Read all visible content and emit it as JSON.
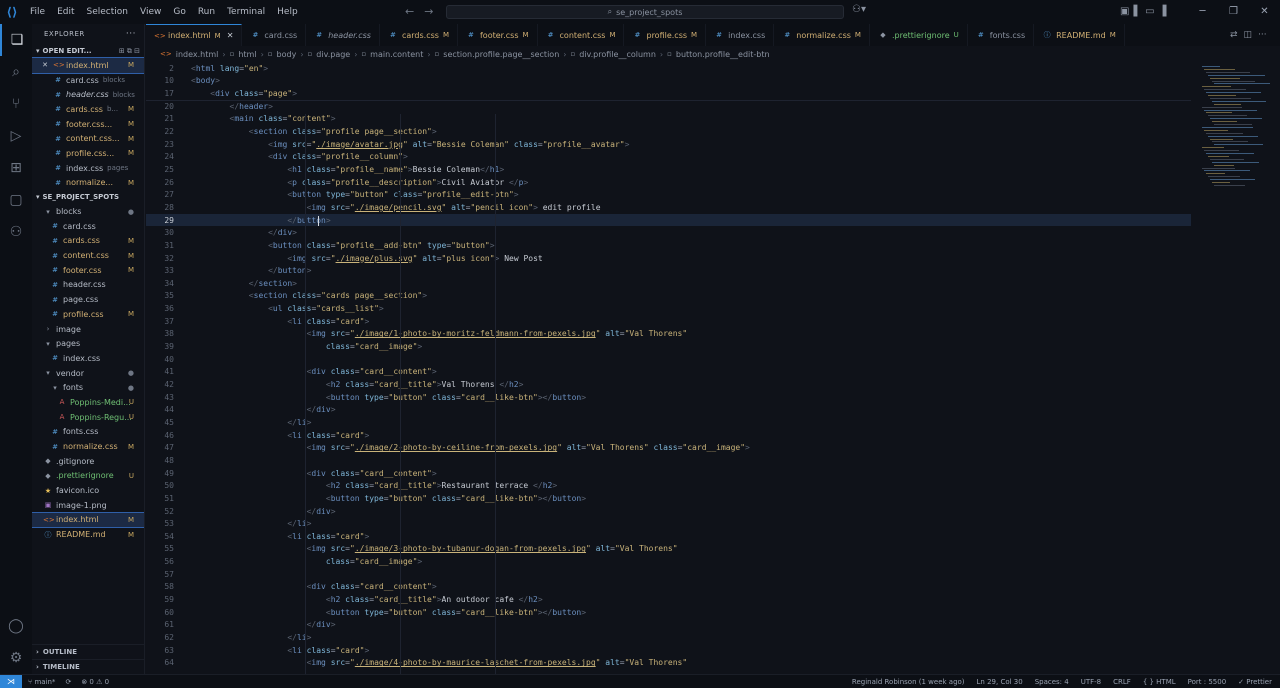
{
  "titlebar": {
    "menu": [
      "File",
      "Edit",
      "Selection",
      "View",
      "Go",
      "Run",
      "Terminal",
      "Help"
    ],
    "search": "se_project_spots"
  },
  "sidebar": {
    "title": "EXPLORER",
    "open_editors_label": "OPEN EDIT...",
    "open_editors": [
      {
        "name": "index.html",
        "desc": "",
        "badge": "M",
        "type": "html",
        "close": true
      },
      {
        "name": "card.css",
        "desc": "blocks",
        "badge": "",
        "type": "css"
      },
      {
        "name": "header.css",
        "desc": "blocks",
        "badge": "",
        "type": "css",
        "italic": true
      },
      {
        "name": "cards.css",
        "desc": "b...",
        "badge": "M",
        "type": "css"
      },
      {
        "name": "footer.css...",
        "desc": "",
        "badge": "M",
        "type": "css"
      },
      {
        "name": "content.css...",
        "desc": "",
        "badge": "M",
        "type": "css"
      },
      {
        "name": "profile.css...",
        "desc": "",
        "badge": "M",
        "type": "css"
      },
      {
        "name": "index.css",
        "desc": "pages",
        "badge": "",
        "type": "css"
      },
      {
        "name": "normalize...",
        "desc": "",
        "badge": "M",
        "type": "css"
      }
    ],
    "project_label": "SE_PROJECT_SPOTS",
    "tree": [
      {
        "name": "blocks",
        "type": "folder",
        "indent": 1,
        "open": true,
        "dot": true
      },
      {
        "name": "card.css",
        "type": "css",
        "indent": 2,
        "badge": ""
      },
      {
        "name": "cards.css",
        "type": "css",
        "indent": 2,
        "badge": "M"
      },
      {
        "name": "content.css",
        "type": "css",
        "indent": 2,
        "badge": "M"
      },
      {
        "name": "footer.css",
        "type": "css",
        "indent": 2,
        "badge": "M"
      },
      {
        "name": "header.css",
        "type": "css",
        "indent": 2,
        "badge": ""
      },
      {
        "name": "page.css",
        "type": "css",
        "indent": 2,
        "badge": ""
      },
      {
        "name": "profile.css",
        "type": "css",
        "indent": 2,
        "badge": "M"
      },
      {
        "name": "image",
        "type": "folder",
        "indent": 1,
        "open": false
      },
      {
        "name": "pages",
        "type": "folder",
        "indent": 1,
        "open": true
      },
      {
        "name": "index.css",
        "type": "css",
        "indent": 2,
        "badge": ""
      },
      {
        "name": "vendor",
        "type": "folder",
        "indent": 1,
        "open": true,
        "dot": true
      },
      {
        "name": "fonts",
        "type": "folder",
        "indent": 2,
        "open": true,
        "dot": true
      },
      {
        "name": "Poppins-Medi...",
        "type": "font",
        "indent": 3,
        "badge": "U"
      },
      {
        "name": "Poppins-Regu...",
        "type": "font",
        "indent": 3,
        "badge": "U"
      },
      {
        "name": "fonts.css",
        "type": "css",
        "indent": 2,
        "badge": ""
      },
      {
        "name": "normalize.css",
        "type": "css",
        "indent": 2,
        "badge": "M"
      },
      {
        "name": ".gitignore",
        "type": "git",
        "indent": 1,
        "badge": ""
      },
      {
        "name": ".prettierignore",
        "type": "git",
        "indent": 1,
        "badge": "U"
      },
      {
        "name": "favicon.ico",
        "type": "star",
        "indent": 1,
        "badge": ""
      },
      {
        "name": "image-1.png",
        "type": "img",
        "indent": 1,
        "badge": ""
      },
      {
        "name": "index.html",
        "type": "html",
        "indent": 1,
        "badge": "M",
        "selected": true
      },
      {
        "name": "README.md",
        "type": "md",
        "indent": 1,
        "badge": "M"
      }
    ],
    "outline_label": "OUTLINE",
    "timeline_label": "TIMELINE"
  },
  "tabs": [
    {
      "name": "index.html",
      "mark": "M",
      "type": "html",
      "active": true,
      "close": true
    },
    {
      "name": "card.css",
      "mark": "",
      "type": "css"
    },
    {
      "name": "header.css",
      "mark": "",
      "type": "css",
      "italic": true
    },
    {
      "name": "cards.css",
      "mark": "M",
      "type": "css"
    },
    {
      "name": "footer.css",
      "mark": "M",
      "type": "css"
    },
    {
      "name": "content.css",
      "mark": "M",
      "type": "css"
    },
    {
      "name": "profile.css",
      "mark": "M",
      "type": "css"
    },
    {
      "name": "index.css",
      "mark": "",
      "type": "css"
    },
    {
      "name": "normalize.css",
      "mark": "M",
      "type": "css"
    },
    {
      "name": ".prettierignore",
      "mark": "U",
      "type": "git"
    },
    {
      "name": "fonts.css",
      "mark": "",
      "type": "css"
    },
    {
      "name": "README.md",
      "mark": "M",
      "type": "md"
    }
  ],
  "breadcrumb": [
    "index.html",
    "html",
    "body",
    "div.page",
    "main.content",
    "section.profile.page__section",
    "div.profile__column",
    "button.profile__edit-btn"
  ],
  "code": [
    {
      "n": "2",
      "html": "<span class='t-dim'>&lt;</span><span class='t-tag'>html</span> <span class='t-attr'>lang</span>=<span class='t-val'>\"en\"</span><span class='t-dim'>&gt;</span>"
    },
    {
      "n": "10",
      "html": "<span class='t-dim'>&lt;</span><span class='t-tag'>body</span><span class='t-dim'>&gt;</span>"
    },
    {
      "n": "17",
      "html": "    <span class='t-dim'>&lt;</span><span class='t-tag'>div</span> <span class='t-attr'>class</span>=<span class='t-val'>\"page\"</span><span class='t-dim'>&gt;</span>"
    },
    {
      "n": "20",
      "html": "        <span class='t-dim'>&lt;/</span><span class='t-tag'>header</span><span class='t-dim'>&gt;</span>"
    },
    {
      "n": "21",
      "html": "        <span class='t-dim'>&lt;</span><span class='t-tag'>main</span> <span class='t-attr'>class</span>=<span class='t-val'>\"content\"</span><span class='t-dim'>&gt;</span>"
    },
    {
      "n": "22",
      "html": "            <span class='t-dim'>&lt;</span><span class='t-tag'>section</span> <span class='t-attr'>class</span>=<span class='t-val'>\"profile page__section\"</span><span class='t-dim'>&gt;</span>"
    },
    {
      "n": "23",
      "html": "                <span class='t-dim'>&lt;</span><span class='t-tag'>img</span> <span class='t-attr'>src</span>=<span class='t-val'>\"<span class='t-link'>./image/avatar.jpg</span>\"</span> <span class='t-attr'>alt</span>=<span class='t-val'>\"Bessie Coleman\"</span> <span class='t-attr'>class</span>=<span class='t-val'>\"profile__avatar\"</span><span class='t-dim'>&gt;</span>"
    },
    {
      "n": "24",
      "html": "                <span class='t-dim'>&lt;</span><span class='t-tag'>div</span> <span class='t-attr'>class</span>=<span class='t-val'>\"profile__column\"</span><span class='t-dim'>&gt;</span>"
    },
    {
      "n": "25",
      "html": "                    <span class='t-dim'>&lt;</span><span class='t-tag'>h1</span> <span class='t-attr'>class</span>=<span class='t-val'>\"profile__name\"</span><span class='t-dim'>&gt;</span><span class='t-text'>Bessie Coleman</span><span class='t-dim'>&lt;/</span><span class='t-tag'>h1</span><span class='t-dim'>&gt;</span>"
    },
    {
      "n": "26",
      "html": "                    <span class='t-dim'>&lt;</span><span class='t-tag'>p</span> <span class='t-attr'>class</span>=<span class='t-val'>\"profile__description\"</span><span class='t-dim'>&gt;</span><span class='t-text'>Civil Aviator </span><span class='t-dim'>&lt;/</span><span class='t-tag'>p</span><span class='t-dim'>&gt;</span>"
    },
    {
      "n": "27",
      "html": "                    <span class='t-dim'>&lt;</span><span class='t-tag'>button</span> <span class='t-attr'>type</span>=<span class='t-val'>\"button\"</span> <span class='t-attr'>class</span>=<span class='t-val'>\"profile__edit-btn\"</span><span class='t-dim'>&gt;</span>"
    },
    {
      "n": "28",
      "html": "                        <span class='t-dim'>&lt;</span><span class='t-tag'>img</span> <span class='t-attr'>src</span>=<span class='t-val'>\"<span class='t-link'>./image/pencil.svg</span>\"</span> <span class='t-attr'>alt</span>=<span class='t-val'>\"pencil icon\"</span><span class='t-dim'>&gt;</span> <span class='t-text'>edit profile</span>"
    },
    {
      "n": "29",
      "html": "                    <span class='t-dim'>&lt;/</span><span class='t-tag'>button</span><span class='t-dim'>&gt;</span>",
      "cur": true
    },
    {
      "n": "30",
      "html": "                <span class='t-dim'>&lt;/</span><span class='t-tag'>div</span><span class='t-dim'>&gt;</span>"
    },
    {
      "n": "31",
      "html": "                <span class='t-dim'>&lt;</span><span class='t-tag'>button</span> <span class='t-attr'>class</span>=<span class='t-val'>\"profile__add-btn\"</span> <span class='t-attr'>type</span>=<span class='t-val'>\"button\"</span><span class='t-dim'>&gt;</span>"
    },
    {
      "n": "32",
      "html": "                    <span class='t-dim'>&lt;</span><span class='t-tag'>img</span> <span class='t-attr'>src</span>=<span class='t-val'>\"<span class='t-link'>./image/plus.svg</span>\"</span> <span class='t-attr'>alt</span>=<span class='t-val'>\"plus icon\"</span><span class='t-dim'>&gt;</span> <span class='t-text'>New Post</span>"
    },
    {
      "n": "33",
      "html": "                <span class='t-dim'>&lt;/</span><span class='t-tag'>button</span><span class='t-dim'>&gt;</span>"
    },
    {
      "n": "34",
      "html": "            <span class='t-dim'>&lt;/</span><span class='t-tag'>section</span><span class='t-dim'>&gt;</span>"
    },
    {
      "n": "35",
      "html": "            <span class='t-dim'>&lt;</span><span class='t-tag'>section</span> <span class='t-attr'>class</span>=<span class='t-val'>\"cards page__section\"</span><span class='t-dim'>&gt;</span>"
    },
    {
      "n": "36",
      "html": "                <span class='t-dim'>&lt;</span><span class='t-tag'>ul</span> <span class='t-attr'>class</span>=<span class='t-val'>\"cards__list\"</span><span class='t-dim'>&gt;</span>"
    },
    {
      "n": "37",
      "html": "                    <span class='t-dim'>&lt;</span><span class='t-tag'>li</span> <span class='t-attr'>class</span>=<span class='t-val'>\"card\"</span><span class='t-dim'>&gt;</span>"
    },
    {
      "n": "38",
      "html": "                        <span class='t-dim'>&lt;</span><span class='t-tag'>img</span> <span class='t-attr'>src</span>=<span class='t-val'>\"<span class='t-link'>./image/1-photo-by-moritz-feldmann-from-pexels.jpg</span>\"</span> <span class='t-attr'>alt</span>=<span class='t-val'>\"Val Thorens\"</span>"
    },
    {
      "n": "39",
      "html": "                            <span class='t-attr'>class</span>=<span class='t-val'>\"card__image\"</span><span class='t-dim'>&gt;</span>"
    },
    {
      "n": "40",
      "html": ""
    },
    {
      "n": "41",
      "html": "                        <span class='t-dim'>&lt;</span><span class='t-tag'>div</span> <span class='t-attr'>class</span>=<span class='t-val'>\"card__content\"</span><span class='t-dim'>&gt;</span>"
    },
    {
      "n": "42",
      "html": "                            <span class='t-dim'>&lt;</span><span class='t-tag'>h2</span> <span class='t-attr'>class</span>=<span class='t-val'>\"card__title\"</span><span class='t-dim'>&gt;</span><span class='t-text'>Val Thorens </span><span class='t-dim'>&lt;/</span><span class='t-tag'>h2</span><span class='t-dim'>&gt;</span>"
    },
    {
      "n": "43",
      "html": "                            <span class='t-dim'>&lt;</span><span class='t-tag'>button</span> <span class='t-attr'>type</span>=<span class='t-val'>\"button\"</span> <span class='t-attr'>class</span>=<span class='t-val'>\"card__like-btn\"</span><span class='t-dim'>&gt;&lt;/</span><span class='t-tag'>button</span><span class='t-dim'>&gt;</span>"
    },
    {
      "n": "44",
      "html": "                        <span class='t-dim'>&lt;/</span><span class='t-tag'>div</span><span class='t-dim'>&gt;</span>"
    },
    {
      "n": "45",
      "html": "                    <span class='t-dim'>&lt;/</span><span class='t-tag'>li</span><span class='t-dim'>&gt;</span>"
    },
    {
      "n": "46",
      "html": "                    <span class='t-dim'>&lt;</span><span class='t-tag'>li</span> <span class='t-attr'>class</span>=<span class='t-val'>\"card\"</span><span class='t-dim'>&gt;</span>"
    },
    {
      "n": "47",
      "html": "                        <span class='t-dim'>&lt;</span><span class='t-tag'>img</span> <span class='t-attr'>src</span>=<span class='t-val'>\"<span class='t-link'>./image/2-photo-by-ceiline-from-pexels.jpg</span>\"</span> <span class='t-attr'>alt</span>=<span class='t-val'>\"Val Thorens\"</span> <span class='t-attr'>class</span>=<span class='t-val'>\"card__image\"</span><span class='t-dim'>&gt;</span>"
    },
    {
      "n": "48",
      "html": ""
    },
    {
      "n": "49",
      "html": "                        <span class='t-dim'>&lt;</span><span class='t-tag'>div</span> <span class='t-attr'>class</span>=<span class='t-val'>\"card__content\"</span><span class='t-dim'>&gt;</span>"
    },
    {
      "n": "50",
      "html": "                            <span class='t-dim'>&lt;</span><span class='t-tag'>h2</span> <span class='t-attr'>class</span>=<span class='t-val'>\"card__title\"</span><span class='t-dim'>&gt;</span><span class='t-text'>Restaurant terrace </span><span class='t-dim'>&lt;/</span><span class='t-tag'>h2</span><span class='t-dim'>&gt;</span>"
    },
    {
      "n": "51",
      "html": "                            <span class='t-dim'>&lt;</span><span class='t-tag'>button</span> <span class='t-attr'>type</span>=<span class='t-val'>\"button\"</span> <span class='t-attr'>class</span>=<span class='t-val'>\"card__like-btn\"</span><span class='t-dim'>&gt;&lt;/</span><span class='t-tag'>button</span><span class='t-dim'>&gt;</span>"
    },
    {
      "n": "52",
      "html": "                        <span class='t-dim'>&lt;/</span><span class='t-tag'>div</span><span class='t-dim'>&gt;</span>"
    },
    {
      "n": "53",
      "html": "                    <span class='t-dim'>&lt;/</span><span class='t-tag'>li</span><span class='t-dim'>&gt;</span>"
    },
    {
      "n": "54",
      "html": "                    <span class='t-dim'>&lt;</span><span class='t-tag'>li</span> <span class='t-attr'>class</span>=<span class='t-val'>\"card\"</span><span class='t-dim'>&gt;</span>"
    },
    {
      "n": "55",
      "html": "                        <span class='t-dim'>&lt;</span><span class='t-tag'>img</span> <span class='t-attr'>src</span>=<span class='t-val'>\"<span class='t-link'>./image/3-photo-by-tubanur-dogan-from-pexels.jpg</span>\"</span> <span class='t-attr'>alt</span>=<span class='t-val'>\"Val Thorens\"</span>"
    },
    {
      "n": "56",
      "html": "                            <span class='t-attr'>class</span>=<span class='t-val'>\"card__image\"</span><span class='t-dim'>&gt;</span>"
    },
    {
      "n": "57",
      "html": ""
    },
    {
      "n": "58",
      "html": "                        <span class='t-dim'>&lt;</span><span class='t-tag'>div</span> <span class='t-attr'>class</span>=<span class='t-val'>\"card__content\"</span><span class='t-dim'>&gt;</span>"
    },
    {
      "n": "59",
      "html": "                            <span class='t-dim'>&lt;</span><span class='t-tag'>h2</span> <span class='t-attr'>class</span>=<span class='t-val'>\"card__title\"</span><span class='t-dim'>&gt;</span><span class='t-text'>An outdoor cafe </span><span class='t-dim'>&lt;/</span><span class='t-tag'>h2</span><span class='t-dim'>&gt;</span>"
    },
    {
      "n": "60",
      "html": "                            <span class='t-dim'>&lt;</span><span class='t-tag'>button</span> <span class='t-attr'>type</span>=<span class='t-val'>\"button\"</span> <span class='t-attr'>class</span>=<span class='t-val'>\"card__like-btn\"</span><span class='t-dim'>&gt;&lt;/</span><span class='t-tag'>button</span><span class='t-dim'>&gt;</span>"
    },
    {
      "n": "61",
      "html": "                        <span class='t-dim'>&lt;/</span><span class='t-tag'>div</span><span class='t-dim'>&gt;</span>"
    },
    {
      "n": "62",
      "html": "                    <span class='t-dim'>&lt;/</span><span class='t-tag'>li</span><span class='t-dim'>&gt;</span>"
    },
    {
      "n": "63",
      "html": "                    <span class='t-dim'>&lt;</span><span class='t-tag'>li</span> <span class='t-attr'>class</span>=<span class='t-val'>\"card\"</span><span class='t-dim'>&gt;</span>"
    },
    {
      "n": "64",
      "html": "                        <span class='t-dim'>&lt;</span><span class='t-tag'>img</span> <span class='t-attr'>src</span>=<span class='t-val'>\"<span class='t-link'>./image/4-photo-by-maurice-laschet-from-pexels.jpg</span>\"</span> <span class='t-attr'>alt</span>=<span class='t-val'>\"Val Thorens\"</span>"
    }
  ],
  "status": {
    "branch": "main*",
    "sync": "⟳",
    "problems": "⊗ 0 ⚠ 0",
    "blame": "Reginald Robinson (1 week ago)",
    "position": "Ln 29, Col 30",
    "spaces": "Spaces: 4",
    "encoding": "UTF-8",
    "eol": "CRLF",
    "language": "{ } HTML",
    "port": "Port : 5500",
    "formatter": "✓ Prettier"
  },
  "colors": {
    "accent": "#2f86d8",
    "modified": "#d2b074",
    "untracked": "#6fbf73"
  }
}
